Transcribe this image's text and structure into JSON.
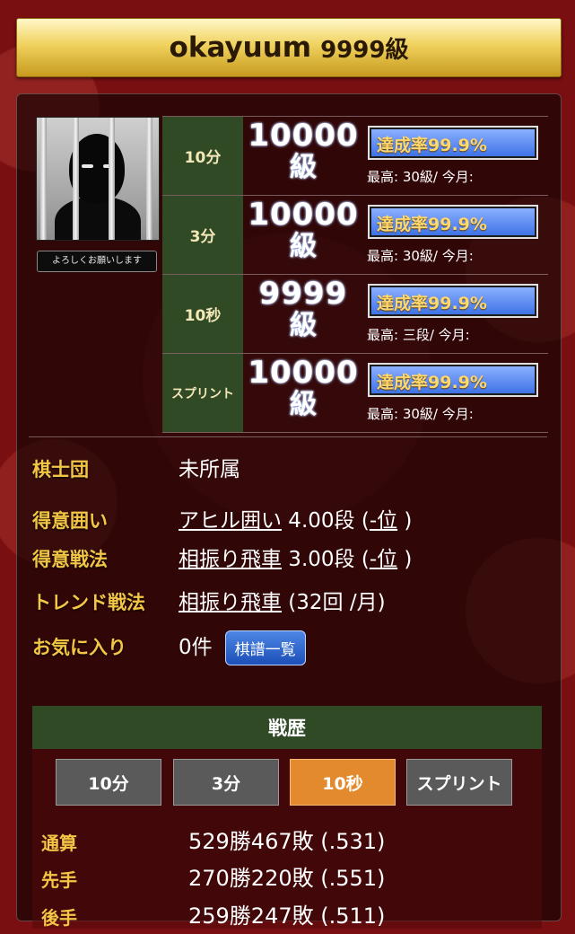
{
  "header": {
    "username": "okayuum",
    "rank": "9999級"
  },
  "profile": {
    "greeting": "よろしくお願いします"
  },
  "ranks": [
    {
      "mode": "10分",
      "rank_number": "10000",
      "rank_unit": "級",
      "achievement": "達成率99.9%",
      "best": "最高: 30級/ 今月:"
    },
    {
      "mode": "3分",
      "rank_number": "10000",
      "rank_unit": "級",
      "achievement": "達成率99.9%",
      "best": "最高: 30級/ 今月:"
    },
    {
      "mode": "10秒",
      "rank_number": "9999",
      "rank_unit": "級",
      "achievement": "達成率99.9%",
      "best": "最高: 三段/ 今月:"
    },
    {
      "mode": "スプリント",
      "rank_number": "10000",
      "rank_unit": "級",
      "achievement": "達成率99.9%",
      "best": "最高: 30級/ 今月:"
    }
  ],
  "info": {
    "team_label": "棋士団",
    "team_value": "未所属",
    "castle_label": "得意囲い",
    "castle_name": "アヒル囲い",
    "castle_grade": " 4.00段 (",
    "castle_rank": "-位",
    "castle_close": " )",
    "strategy_label": "得意戦法",
    "strategy_name": "相振り飛車",
    "strategy_grade": " 3.00段 (",
    "strategy_rank": "-位",
    "strategy_close": " )",
    "trend_label": "トレンド戦法",
    "trend_name": "相振り飛車",
    "trend_detail": " (32回 /月)",
    "fav_label": "お気に入り",
    "fav_value": "0件",
    "kifu_button": "棋譜一覧"
  },
  "record": {
    "title": "戦歴",
    "tabs": [
      "10分",
      "3分",
      "10秒",
      "スプリント"
    ],
    "active_tab": "10秒",
    "stats": [
      {
        "label": "通算",
        "value": "529勝467敗 (.531)"
      },
      {
        "label": "先手",
        "value": "270勝220敗 (.551)"
      },
      {
        "label": "後手",
        "value": "259勝247敗 (.511)"
      }
    ]
  }
}
